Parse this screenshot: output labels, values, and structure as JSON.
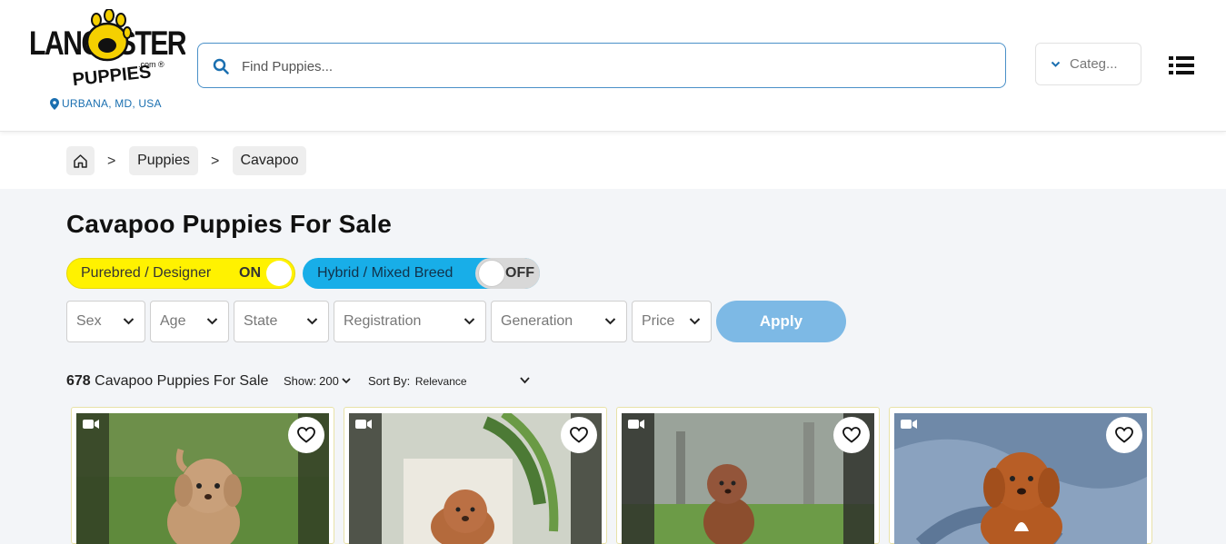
{
  "header": {
    "logo_text_top": "LANCASTER",
    "logo_text_bottom": "PUPPIES",
    "logo_domain": ".com ®",
    "location": "URBANA, MD, USA",
    "search_placeholder": "Find Puppies...",
    "category_label": "Categ...",
    "accent_color": "#1a6fb0"
  },
  "breadcrumb": {
    "items": [
      "Puppies",
      "Cavapoo"
    ],
    "separator": ">"
  },
  "main": {
    "title": "Cavapoo Puppies For Sale",
    "toggles": {
      "purebred": {
        "label": "Purebred / Designer",
        "state": "ON",
        "color": "#fff200"
      },
      "hybrid": {
        "label": "Hybrid / Mixed Breed",
        "state": "OFF",
        "color": "#18aee8"
      }
    },
    "filters": [
      "Sex",
      "Age",
      "State",
      "Registration",
      "Generation",
      "Price"
    ],
    "apply_label": "Apply",
    "count": "678",
    "count_suffix": "Cavapoo Puppies For Sale",
    "show_label": "Show:",
    "show_value": "200",
    "sort_label": "Sort By:",
    "sort_value": "Relevance"
  },
  "cards": [
    {
      "has_video": true,
      "favorite": false
    },
    {
      "has_video": true,
      "favorite": false
    },
    {
      "has_video": true,
      "favorite": false
    },
    {
      "has_video": true,
      "favorite": false
    }
  ]
}
